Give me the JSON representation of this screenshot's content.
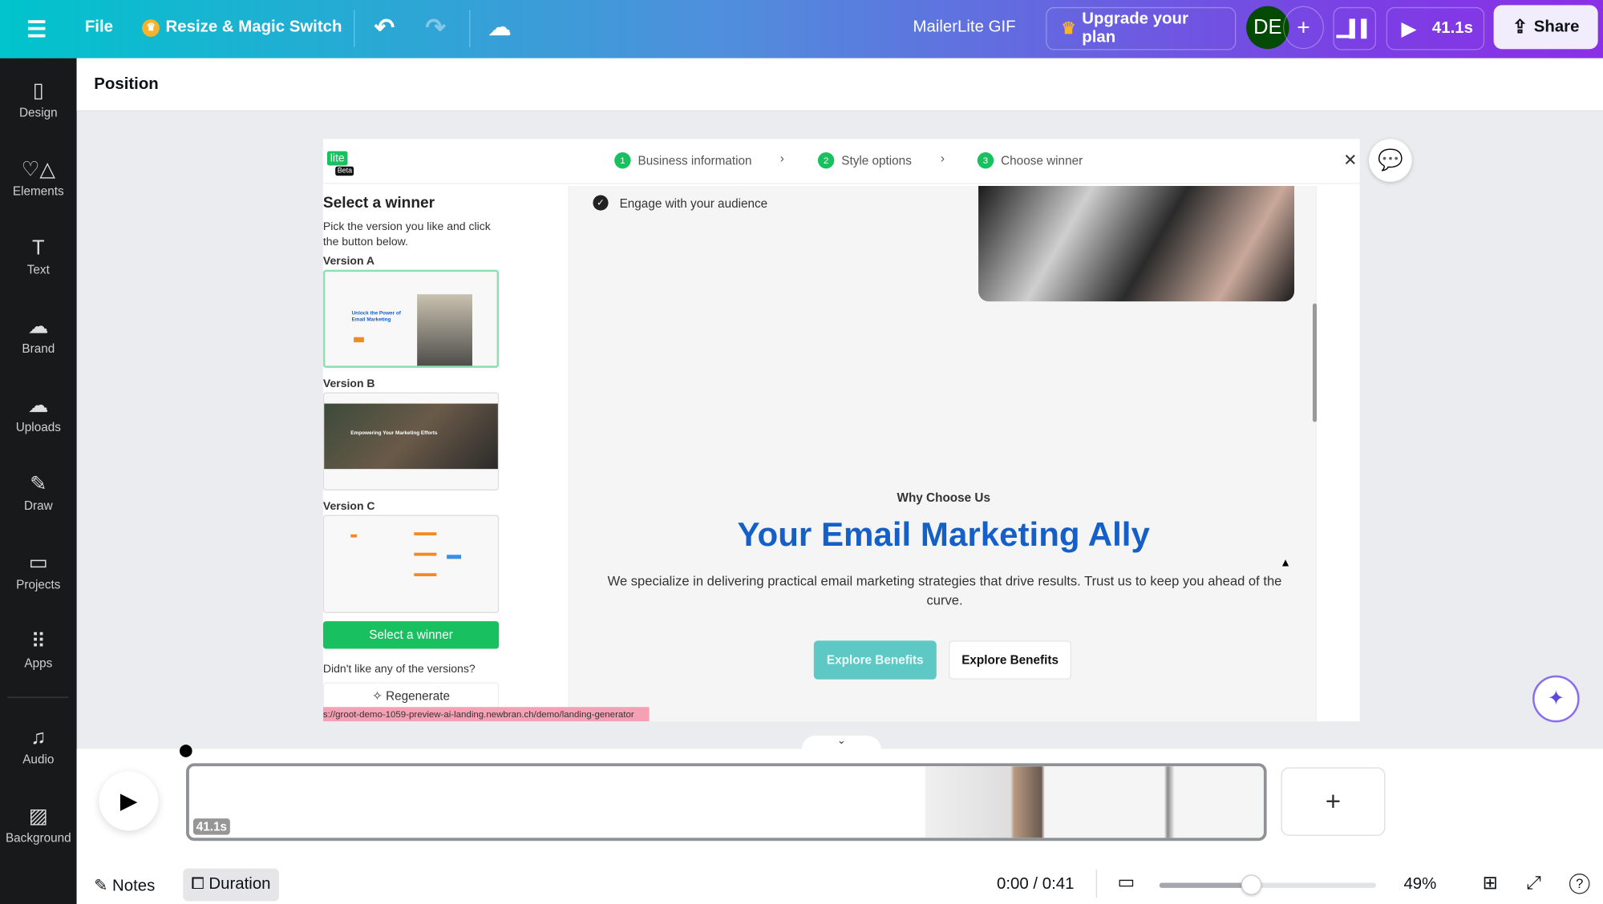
{
  "topbar": {
    "menu_icon": "hamburger-icon",
    "file": "File",
    "resize": "Resize & Magic Switch",
    "title": "MailerLite GIF",
    "upgrade": "Upgrade your plan",
    "avatar": "DE",
    "play_time": "41.1s",
    "share": "Share"
  },
  "sidebar": {
    "items": [
      {
        "label": "Design",
        "icon": "▯"
      },
      {
        "label": "Elements",
        "icon": "♡△"
      },
      {
        "label": "Text",
        "icon": "T"
      },
      {
        "label": "Brand",
        "icon": "☁"
      },
      {
        "label": "Uploads",
        "icon": "☁"
      },
      {
        "label": "Draw",
        "icon": "✎"
      },
      {
        "label": "Projects",
        "icon": "▭"
      },
      {
        "label": "Apps",
        "icon": "⠿"
      },
      {
        "label": "Audio",
        "icon": "♫"
      },
      {
        "label": "Background",
        "icon": "▨"
      }
    ]
  },
  "position_label": "Position",
  "page": {
    "logo": "lite",
    "logo_badge": "Beta",
    "steps": [
      {
        "n": "1",
        "label": "Business information"
      },
      {
        "n": "2",
        "label": "Style options"
      },
      {
        "n": "3",
        "label": "Choose winner"
      }
    ],
    "left": {
      "title": "Select a winner",
      "desc": "Pick the version you like and click the button below.",
      "versions": [
        "Version A",
        "Version B",
        "Version C"
      ],
      "thumb_a": "Unlock the Power of Email Marketing",
      "thumb_b": "Empowering Your Marketing Efforts",
      "select_btn": "Select a winner",
      "didnt_like": "Didn't like any of the versions?",
      "regenerate": "Regenerate"
    },
    "main": {
      "check_item": "Engage with your audience",
      "eyebrow": "Why Choose Us",
      "heading": "Your Email Marketing Ally",
      "body": "We specialize in delivering practical email marketing strategies that drive results. Trust us to keep you ahead of the curve.",
      "btn1": "Explore Benefits",
      "btn2": "Explore Benefits"
    },
    "url": "s://groot-demo-1059-preview-ai-landing.newbran.ch/demo/landing-generator"
  },
  "timeline": {
    "duration_badge": "41.1s"
  },
  "bottom": {
    "notes": "Notes",
    "duration": "Duration",
    "time": "0:00 / 0:41",
    "zoom_percent": "49%",
    "zoom_value": 49
  },
  "colors": {
    "accent_green": "#19c060",
    "heading_blue": "#1560c8",
    "teal_btn": "#5ec8c4",
    "avatar": "#044a04"
  }
}
